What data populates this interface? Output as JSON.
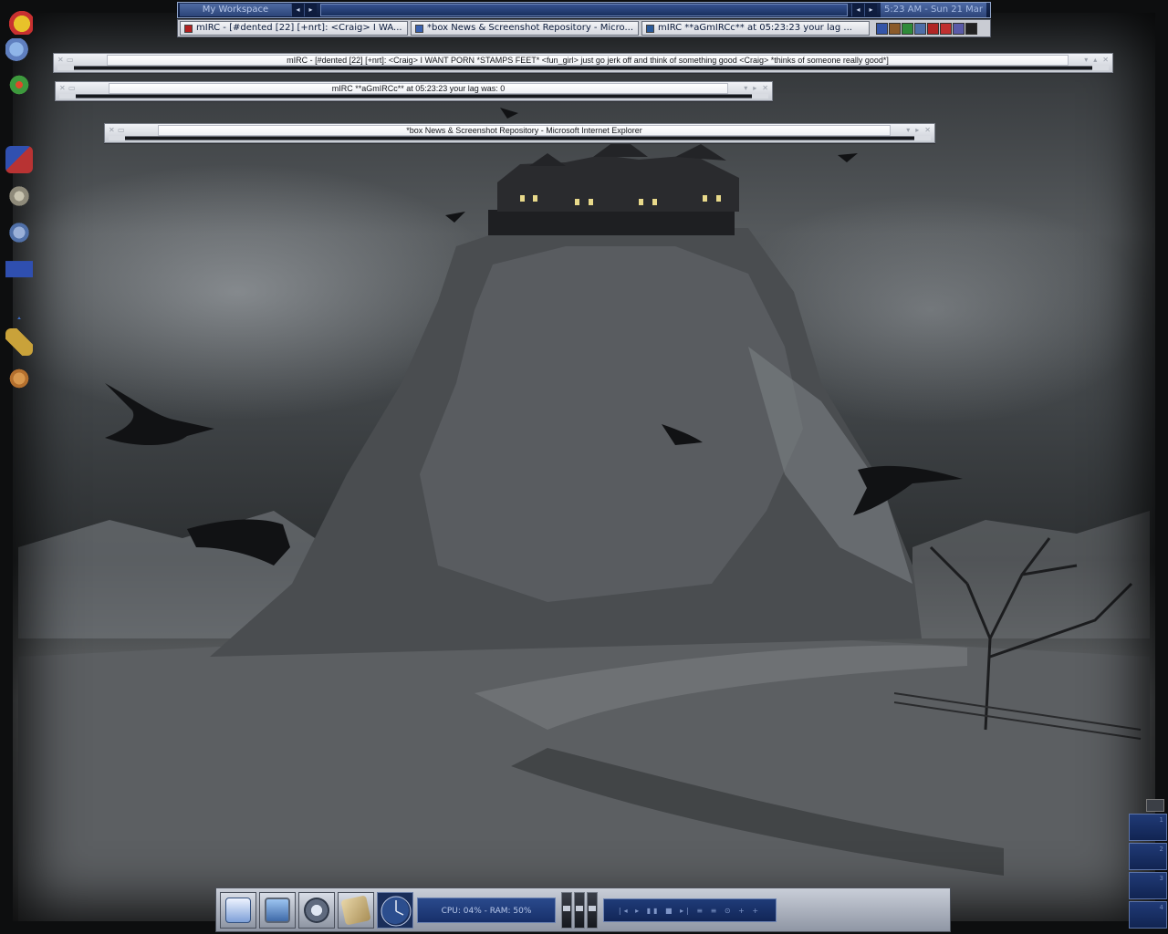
{
  "workspace_bar": {
    "workspace_label": "My Workspace",
    "clock": "5:23 AM - Sun 21 Mar"
  },
  "taskbar": {
    "tasks": [
      {
        "label": "mIRC - [#dented [22] [+nrt]: <Craig> I WA...",
        "icon_color": "#b32020"
      },
      {
        "label": "*box News & Screenshot Repository - Micro...",
        "icon_color": "#3a62b0"
      },
      {
        "label": "mIRC **aGmIRCc** at 05:23:23 your lag ...",
        "icon_color": "#2a5a9a"
      }
    ],
    "tray_icons": [
      {
        "name": "tray-app-icon-1",
        "color": "#3455a8"
      },
      {
        "name": "tray-app-icon-2",
        "color": "#8a5a2a"
      },
      {
        "name": "tray-app-icon-3",
        "color": "#2f8a3a"
      },
      {
        "name": "tray-app-icon-4",
        "color": "#4e6ea8"
      },
      {
        "name": "tray-app-icon-5",
        "color": "#b02525"
      },
      {
        "name": "tray-app-icon-6",
        "color": "#c03030"
      },
      {
        "name": "tray-app-icon-7",
        "color": "#5a5aa8"
      },
      {
        "name": "tray-app-icon-8",
        "color": "#222222"
      }
    ]
  },
  "windows": [
    {
      "title": "mIRC - [#dented [22] [+nrt]: <Craig> I WANT PORN *STAMPS FEET* <fun_girl> just go jerk off and think of something good <Craig> *thinks of someone really good*]"
    },
    {
      "title": "mIRC **aGmIRCc** at 05:23:23 your lag was: 0"
    },
    {
      "title": "*box News & Screenshot Repository - Microsoft Internet Explorer"
    }
  ],
  "desktop_icons": [
    {
      "name": "yahoo-messenger-icon",
      "color": "#c83030"
    },
    {
      "name": "msn-buddies-icon",
      "color": "#5f7fbf"
    },
    {
      "name": "icq-lite-icon",
      "color": "#3d9a3d"
    },
    {
      "name": "mirc-icon",
      "color": "#b83333"
    },
    {
      "name": "winamp-icon",
      "color": "#8e8a7a"
    },
    {
      "name": "flashget-icon",
      "color": "#5070a8"
    },
    {
      "name": "arrow-app-icon",
      "color": "#2f4fb0"
    },
    {
      "name": "triangle-app-icon",
      "color": "#3f6fc8"
    },
    {
      "name": "gold-app-icon",
      "color": "#c9a23a"
    },
    {
      "name": "bear-app-icon",
      "color": "#b4702e"
    }
  ],
  "dock": {
    "system_monitor": "CPU: 04% - RAM: 50%",
    "player_controls": "|◂ ▸ ▮▮ ■ ▸| ≡ ≡ ⊙ + +"
  },
  "colors": {
    "bar_navy": "#0c1a3c",
    "bar_accent": "#4d6aa6",
    "window_chrome": "#c8ccd4"
  }
}
